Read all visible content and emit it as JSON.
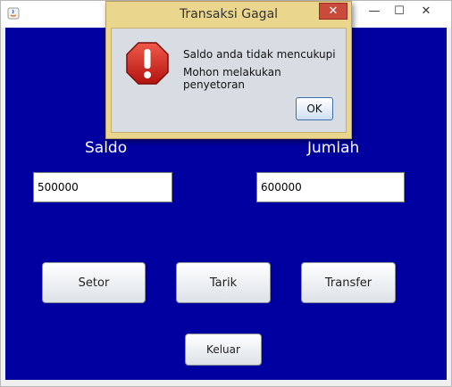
{
  "window": {
    "minimize_glyph": "—",
    "maximize_glyph": "☐",
    "close_glyph": "✕"
  },
  "form": {
    "saldo_label": "Saldo",
    "jumlah_label": "Jumlah",
    "saldo_value": "500000",
    "jumlah_value": "600000",
    "background_color": "#0000a0"
  },
  "buttons": {
    "setor": "Setor",
    "tarik": "Tarik",
    "transfer": "Transfer",
    "keluar": "Keluar"
  },
  "dialog": {
    "title": "Transaksi Gagal",
    "close_glyph": "✕",
    "message_line1": "Saldo anda tidak mencukupi",
    "message_line2": "Mohon melakukan penyetoran",
    "ok_label": "OK",
    "icon": "error-stop-icon"
  }
}
